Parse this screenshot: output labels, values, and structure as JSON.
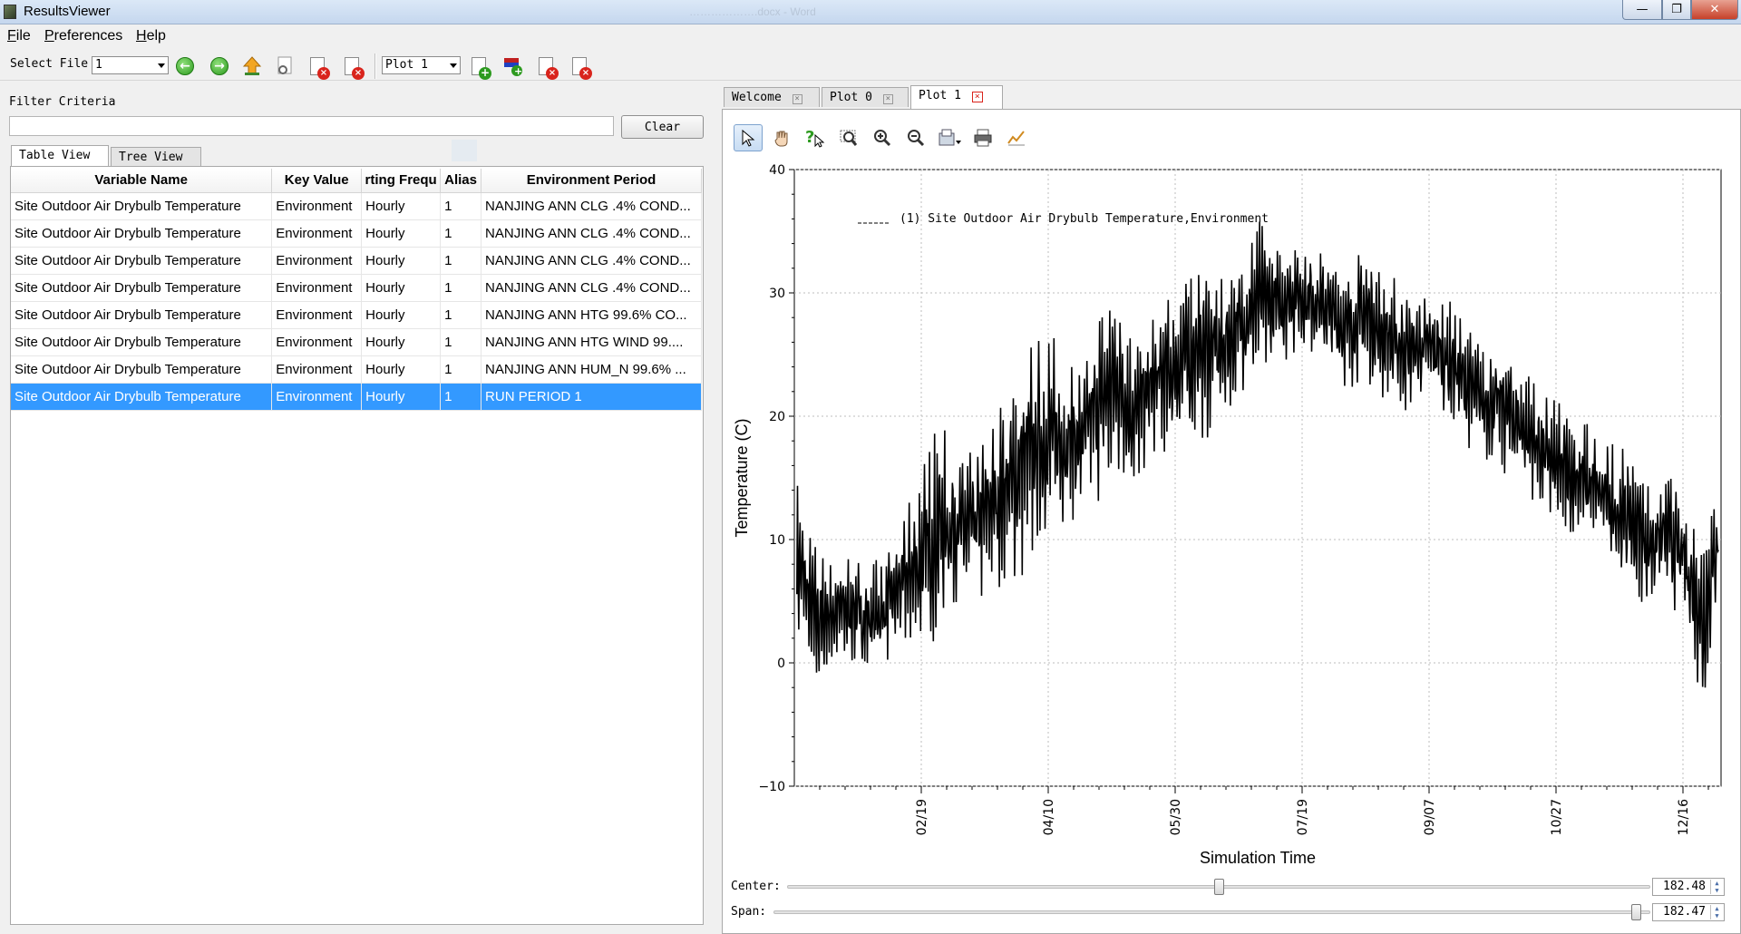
{
  "window": {
    "title": "ResultsViewer",
    "background_doc_title": "……………….docx - Word"
  },
  "menu": {
    "file": "File",
    "preferences": "Preferences",
    "help": "Help"
  },
  "toolbar": {
    "select_file_label": "Select File",
    "select_file_value": "1",
    "plot_select_value": "Plot 1"
  },
  "filter": {
    "label": "Filter Criteria",
    "value": "",
    "clear_label": "Clear"
  },
  "view_tabs": [
    "Table View",
    "Tree View"
  ],
  "table": {
    "columns": [
      "Variable Name",
      "Key Value",
      "rting Frequ",
      "Alias",
      "Environment Period"
    ],
    "rows": [
      [
        "Site Outdoor Air Drybulb Temperature",
        "Environment",
        "Hourly",
        "1",
        "NANJING ANN CLG .4% COND..."
      ],
      [
        "Site Outdoor Air Drybulb Temperature",
        "Environment",
        "Hourly",
        "1",
        "NANJING ANN CLG .4% COND..."
      ],
      [
        "Site Outdoor Air Drybulb Temperature",
        "Environment",
        "Hourly",
        "1",
        "NANJING ANN CLG .4% COND..."
      ],
      [
        "Site Outdoor Air Drybulb Temperature",
        "Environment",
        "Hourly",
        "1",
        "NANJING ANN CLG .4% COND..."
      ],
      [
        "Site Outdoor Air Drybulb Temperature",
        "Environment",
        "Hourly",
        "1",
        "NANJING ANN HTG 99.6% CO..."
      ],
      [
        "Site Outdoor Air Drybulb Temperature",
        "Environment",
        "Hourly",
        "1",
        "NANJING ANN HTG WIND 99...."
      ],
      [
        "Site Outdoor Air Drybulb Temperature",
        "Environment",
        "Hourly",
        "1",
        "NANJING ANN HUM_N 99.6% ..."
      ],
      [
        "Site Outdoor Air Drybulb Temperature",
        "Environment",
        "Hourly",
        "1",
        "RUN PERIOD 1"
      ]
    ],
    "selected_row": 7
  },
  "plot_tabs": [
    "Welcome",
    "Plot 0",
    "Plot 1"
  ],
  "active_plot_tab": "Plot 1",
  "plot_tools": [
    "select-arrow-icon",
    "pan-hand-icon",
    "help-arrow-icon",
    "zoom-window-icon",
    "zoom-in-icon",
    "zoom-out-icon",
    "export-icon",
    "print-icon",
    "line-style-icon"
  ],
  "sliders": {
    "center_label": "Center:",
    "center_value": "182.48",
    "center_fraction": 0.5,
    "span_label": "Span:",
    "span_value": "182.47",
    "span_fraction": 0.99
  },
  "colors": {
    "selection": "#3399ff",
    "series": "#000000",
    "close_accent": "#d9241c"
  },
  "chart_data": {
    "type": "line",
    "xlabel": "Simulation Time",
    "ylabel": "Temperature (C)",
    "legend": "(1) Site Outdoor Air Drybulb Temperature,Environment",
    "legend_position": "top-left",
    "grid": true,
    "x_ticks": [
      "02/19",
      "04/10",
      "05/30",
      "07/19",
      "09/07",
      "10/27",
      "12/16"
    ],
    "x_tick_days": [
      50,
      100,
      150,
      200,
      250,
      300,
      350
    ],
    "xlim": [
      0,
      365
    ],
    "ylim": [
      -10,
      40
    ],
    "y_ticks": [
      -10,
      0,
      10,
      20,
      30,
      40
    ],
    "series": [
      {
        "x": [
          1,
          8,
          15,
          22,
          29,
          36,
          43,
          50,
          57,
          64,
          71,
          78,
          85,
          92,
          99,
          106,
          113,
          120,
          127,
          134,
          141,
          148,
          155,
          162,
          169,
          176,
          183,
          190,
          197,
          204,
          211,
          218,
          225,
          232,
          239,
          246,
          253,
          260,
          267,
          274,
          281,
          288,
          295,
          302,
          309,
          316,
          323,
          330,
          337,
          344,
          351,
          358,
          364
        ],
        "y_min": [
          2,
          -3,
          0,
          0,
          -1,
          0,
          1,
          1,
          2,
          5,
          4,
          6,
          6,
          7,
          9,
          11,
          12,
          13,
          15,
          14,
          17,
          17,
          18,
          18,
          20,
          22,
          23,
          24,
          25,
          25,
          24,
          22,
          23,
          21,
          20,
          21,
          20,
          19,
          17,
          16,
          15,
          14,
          12,
          10,
          10,
          9,
          7,
          6,
          4,
          5,
          3,
          -4,
          6
        ],
        "y_max": [
          15,
          10,
          8,
          9,
          8,
          9,
          12,
          16,
          20,
          17,
          18,
          20,
          23,
          26,
          28,
          25,
          24,
          29,
          31,
          26,
          28,
          30,
          32,
          33,
          31,
          33,
          36,
          34,
          35,
          34,
          33,
          32,
          34,
          32,
          31,
          30,
          31,
          29,
          27,
          26,
          26,
          24,
          22,
          21,
          20,
          19,
          18,
          17,
          15,
          16,
          13,
          11,
          15
        ]
      }
    ]
  }
}
